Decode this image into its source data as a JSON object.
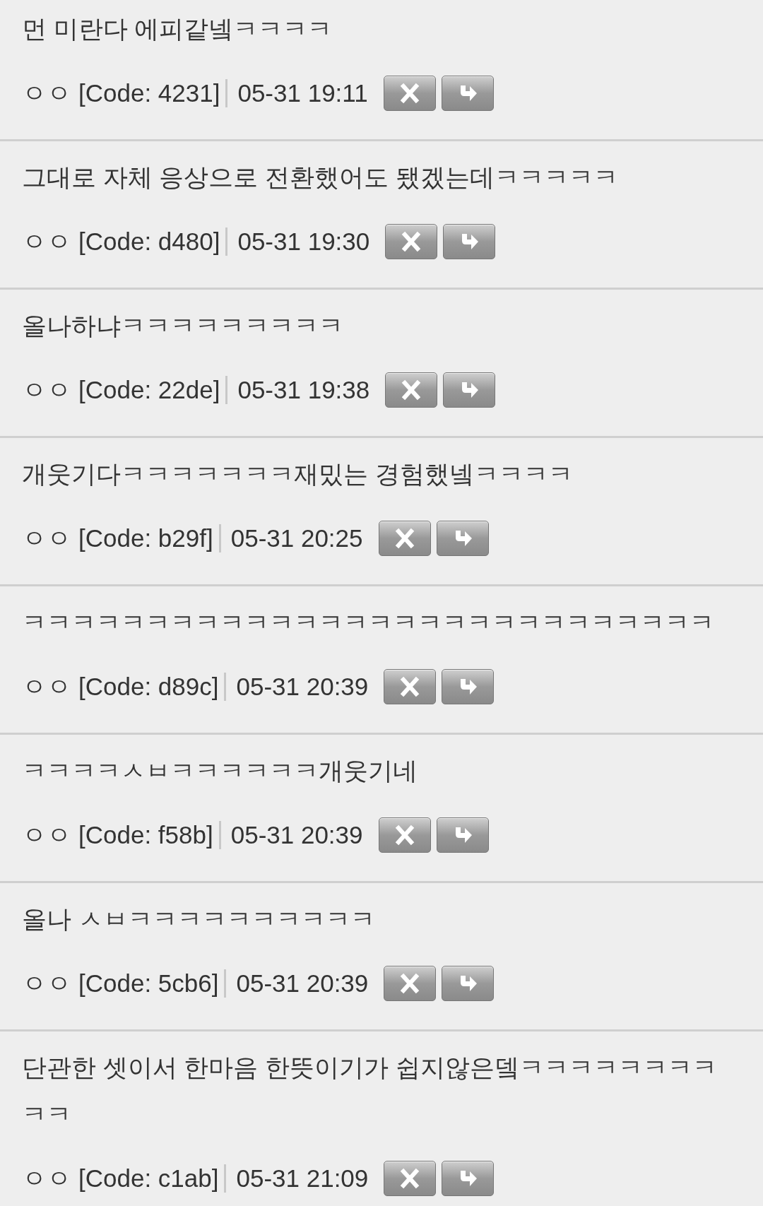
{
  "comments": [
    {
      "text": "먼 미란다 에피같넼ㅋㅋㅋㅋ",
      "author": "ㅇㅇ",
      "code": "[Code: 4231]",
      "date": "05-31 19:11"
    },
    {
      "text": "그대로 자체 응상으로 전환했어도 됐겠는데ㅋㅋㅋㅋㅋ",
      "author": "ㅇㅇ",
      "code": "[Code: d480]",
      "date": "05-31 19:30"
    },
    {
      "text": "올나하냐ㅋㅋㅋㅋㅋㅋㅋㅋㅋ",
      "author": "ㅇㅇ",
      "code": "[Code: 22de]",
      "date": "05-31 19:38"
    },
    {
      "text": "개웃기다ㅋㅋㅋㅋㅋㅋㅋ재밌는 경험했넼ㅋㅋㅋㅋ",
      "author": "ㅇㅇ",
      "code": "[Code: b29f]",
      "date": "05-31 20:25"
    },
    {
      "text": "ㅋㅋㅋㅋㅋㅋㅋㅋㅋㅋㅋㅋㅋㅋㅋㅋㅋㅋㅋㅋㅋㅋㅋㅋㅋㅋㅋㅋ",
      "author": "ㅇㅇ",
      "code": "[Code: d89c]",
      "date": "05-31 20:39"
    },
    {
      "text": "ㅋㅋㅋㅋㅅㅂㅋㅋㅋㅋㅋㅋ개웃기네",
      "author": "ㅇㅇ",
      "code": "[Code: f58b]",
      "date": "05-31 20:39"
    },
    {
      "text": "올나 ㅅㅂㅋㅋㅋㅋㅋㅋㅋㅋㅋㅋ",
      "author": "ㅇㅇ",
      "code": "[Code: 5cb6]",
      "date": "05-31 20:39"
    },
    {
      "text": "단관한 셋이서 한마음 한뜻이기가 쉽지않은뎈ㅋㅋㅋㅋㅋㅋㅋㅋㅋㅋ",
      "author": "ㅇㅇ",
      "code": "[Code: c1ab]",
      "date": "05-31 21:09"
    }
  ]
}
